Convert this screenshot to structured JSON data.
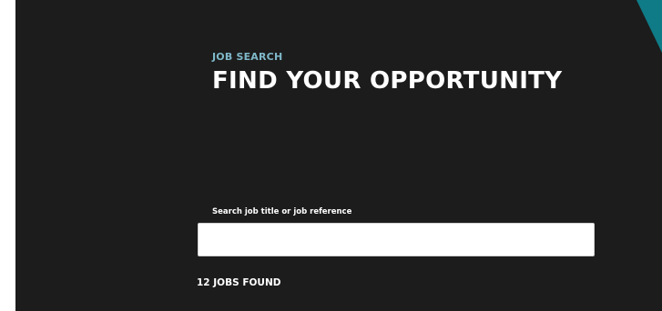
{
  "hero": {
    "eyebrow": "JOB SEARCH",
    "title": "FIND YOUR OPPORTUNITY"
  },
  "search": {
    "label": "Search job title or job reference",
    "value": "",
    "placeholder": ""
  },
  "results": {
    "count_text": "12 JOBS FOUND"
  },
  "colors": {
    "background": "#1c1c1c",
    "eyebrow": "#7fb8c9",
    "accent": "#0f7b86",
    "text": "#ffffff"
  }
}
